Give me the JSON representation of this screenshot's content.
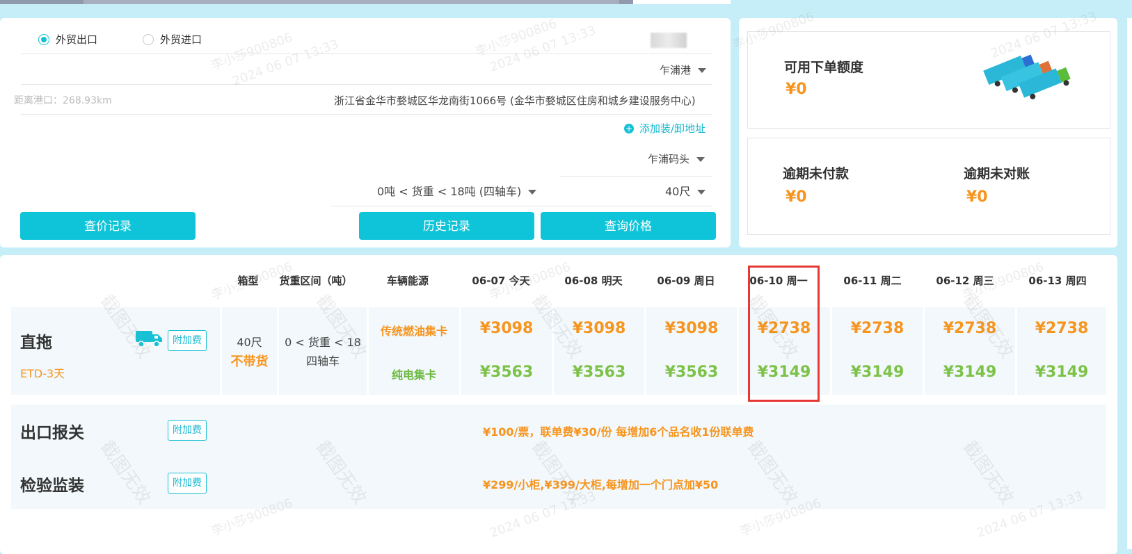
{
  "form": {
    "trade_export": "外贸出口",
    "trade_import": "外贸进口",
    "port": "乍浦港",
    "distance": "距离港口：268.93km",
    "address": "浙江省金华市婺城区华龙南街1066号 (金华市婺城区住房和城乡建设服务中心)",
    "add_address": "添加装/卸地址",
    "terminal": "乍浦码头",
    "weight_range": "0吨 < 货重 < 18吨 (四轴车)",
    "container_size": "40尺",
    "btn_query_records": "查价记录",
    "btn_history": "历史记录",
    "btn_query_price": "查询价格"
  },
  "credit": {
    "available_label": "可用下单额度",
    "available_value": "¥0",
    "overdue_unpaid_label": "逾期未付款",
    "overdue_unpaid_value": "¥0",
    "overdue_unreconciled_label": "逾期未对账",
    "overdue_unreconciled_value": "¥0"
  },
  "table": {
    "headers": {
      "box_type": "箱型",
      "weight_range": "货重区间（吨）",
      "energy": "车辆能源",
      "days": [
        "06-07 今天",
        "06-08 明天",
        "06-09 周日",
        "06-10 周一",
        "06-11 周二",
        "06-12 周三",
        "06-13 周四"
      ]
    },
    "direct": {
      "title": "直拖",
      "etd": "ETD-3天",
      "surcharge": "附加费",
      "box": "40尺",
      "no_cargo": "不带货",
      "weight_line1": "0 < 货重 < 18",
      "weight_line2": "四轴车",
      "fuel": "传统燃油集卡",
      "electric": "纯电集卡",
      "fuel_prices": [
        "¥3098",
        "¥3098",
        "¥3098",
        "¥2738",
        "¥2738",
        "¥2738",
        "¥2738"
      ],
      "electric_prices": [
        "¥3563",
        "¥3563",
        "¥3563",
        "¥3149",
        "¥3149",
        "¥3149",
        "¥3149"
      ]
    },
    "customs": {
      "title": "出口报关",
      "surcharge": "附加费",
      "text": "¥100/票，联单费¥30/份   每增加6个品名收1份联单费"
    },
    "inspection": {
      "title": "检验监装",
      "surcharge": "附加费",
      "text": "¥299/小柜,¥399/大柜,每增加一个门点加¥50"
    }
  },
  "watermark": {
    "user": "李小莎900806",
    "date": "2024 06 07 13:33",
    "invalid": "截图无效"
  }
}
